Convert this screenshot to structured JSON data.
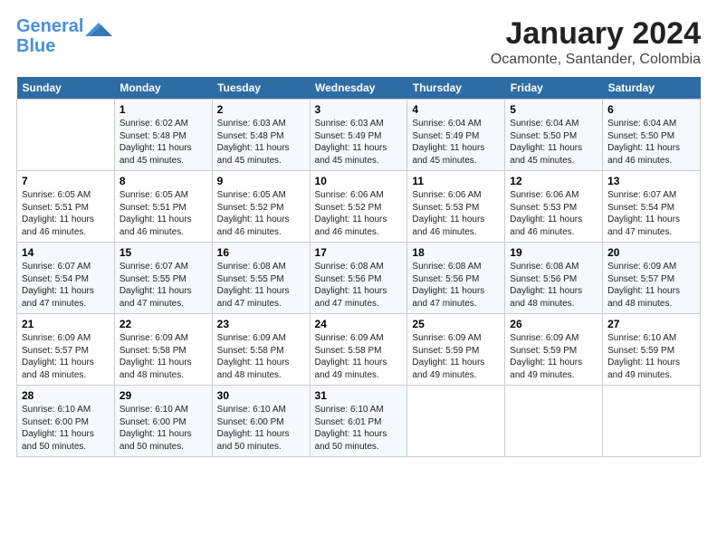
{
  "logo": {
    "line1": "General",
    "line2": "Blue"
  },
  "header": {
    "title": "January 2024",
    "subtitle": "Ocamonte, Santander, Colombia"
  },
  "days_of_week": [
    "Sunday",
    "Monday",
    "Tuesday",
    "Wednesday",
    "Thursday",
    "Friday",
    "Saturday"
  ],
  "weeks": [
    [
      {
        "day": "",
        "info": ""
      },
      {
        "day": "1",
        "info": "Sunrise: 6:02 AM\nSunset: 5:48 PM\nDaylight: 11 hours\nand 45 minutes."
      },
      {
        "day": "2",
        "info": "Sunrise: 6:03 AM\nSunset: 5:48 PM\nDaylight: 11 hours\nand 45 minutes."
      },
      {
        "day": "3",
        "info": "Sunrise: 6:03 AM\nSunset: 5:49 PM\nDaylight: 11 hours\nand 45 minutes."
      },
      {
        "day": "4",
        "info": "Sunrise: 6:04 AM\nSunset: 5:49 PM\nDaylight: 11 hours\nand 45 minutes."
      },
      {
        "day": "5",
        "info": "Sunrise: 6:04 AM\nSunset: 5:50 PM\nDaylight: 11 hours\nand 45 minutes."
      },
      {
        "day": "6",
        "info": "Sunrise: 6:04 AM\nSunset: 5:50 PM\nDaylight: 11 hours\nand 46 minutes."
      }
    ],
    [
      {
        "day": "7",
        "info": "Sunrise: 6:05 AM\nSunset: 5:51 PM\nDaylight: 11 hours\nand 46 minutes."
      },
      {
        "day": "8",
        "info": "Sunrise: 6:05 AM\nSunset: 5:51 PM\nDaylight: 11 hours\nand 46 minutes."
      },
      {
        "day": "9",
        "info": "Sunrise: 6:05 AM\nSunset: 5:52 PM\nDaylight: 11 hours\nand 46 minutes."
      },
      {
        "day": "10",
        "info": "Sunrise: 6:06 AM\nSunset: 5:52 PM\nDaylight: 11 hours\nand 46 minutes."
      },
      {
        "day": "11",
        "info": "Sunrise: 6:06 AM\nSunset: 5:53 PM\nDaylight: 11 hours\nand 46 minutes."
      },
      {
        "day": "12",
        "info": "Sunrise: 6:06 AM\nSunset: 5:53 PM\nDaylight: 11 hours\nand 46 minutes."
      },
      {
        "day": "13",
        "info": "Sunrise: 6:07 AM\nSunset: 5:54 PM\nDaylight: 11 hours\nand 47 minutes."
      }
    ],
    [
      {
        "day": "14",
        "info": "Sunrise: 6:07 AM\nSunset: 5:54 PM\nDaylight: 11 hours\nand 47 minutes."
      },
      {
        "day": "15",
        "info": "Sunrise: 6:07 AM\nSunset: 5:55 PM\nDaylight: 11 hours\nand 47 minutes."
      },
      {
        "day": "16",
        "info": "Sunrise: 6:08 AM\nSunset: 5:55 PM\nDaylight: 11 hours\nand 47 minutes."
      },
      {
        "day": "17",
        "info": "Sunrise: 6:08 AM\nSunset: 5:56 PM\nDaylight: 11 hours\nand 47 minutes."
      },
      {
        "day": "18",
        "info": "Sunrise: 6:08 AM\nSunset: 5:56 PM\nDaylight: 11 hours\nand 47 minutes."
      },
      {
        "day": "19",
        "info": "Sunrise: 6:08 AM\nSunset: 5:56 PM\nDaylight: 11 hours\nand 48 minutes."
      },
      {
        "day": "20",
        "info": "Sunrise: 6:09 AM\nSunset: 5:57 PM\nDaylight: 11 hours\nand 48 minutes."
      }
    ],
    [
      {
        "day": "21",
        "info": "Sunrise: 6:09 AM\nSunset: 5:57 PM\nDaylight: 11 hours\nand 48 minutes."
      },
      {
        "day": "22",
        "info": "Sunrise: 6:09 AM\nSunset: 5:58 PM\nDaylight: 11 hours\nand 48 minutes."
      },
      {
        "day": "23",
        "info": "Sunrise: 6:09 AM\nSunset: 5:58 PM\nDaylight: 11 hours\nand 48 minutes."
      },
      {
        "day": "24",
        "info": "Sunrise: 6:09 AM\nSunset: 5:58 PM\nDaylight: 11 hours\nand 49 minutes."
      },
      {
        "day": "25",
        "info": "Sunrise: 6:09 AM\nSunset: 5:59 PM\nDaylight: 11 hours\nand 49 minutes."
      },
      {
        "day": "26",
        "info": "Sunrise: 6:09 AM\nSunset: 5:59 PM\nDaylight: 11 hours\nand 49 minutes."
      },
      {
        "day": "27",
        "info": "Sunrise: 6:10 AM\nSunset: 5:59 PM\nDaylight: 11 hours\nand 49 minutes."
      }
    ],
    [
      {
        "day": "28",
        "info": "Sunrise: 6:10 AM\nSunset: 6:00 PM\nDaylight: 11 hours\nand 50 minutes."
      },
      {
        "day": "29",
        "info": "Sunrise: 6:10 AM\nSunset: 6:00 PM\nDaylight: 11 hours\nand 50 minutes."
      },
      {
        "day": "30",
        "info": "Sunrise: 6:10 AM\nSunset: 6:00 PM\nDaylight: 11 hours\nand 50 minutes."
      },
      {
        "day": "31",
        "info": "Sunrise: 6:10 AM\nSunset: 6:01 PM\nDaylight: 11 hours\nand 50 minutes."
      },
      {
        "day": "",
        "info": ""
      },
      {
        "day": "",
        "info": ""
      },
      {
        "day": "",
        "info": ""
      }
    ]
  ]
}
